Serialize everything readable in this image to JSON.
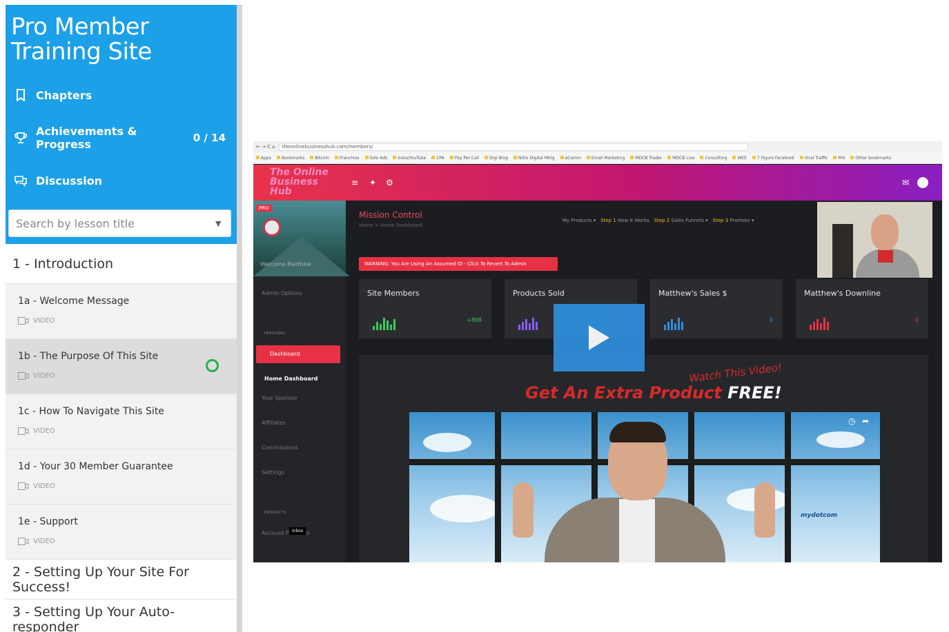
{
  "sidebar": {
    "title": "Pro Member Training Site",
    "nav": {
      "chapters": "Chapters",
      "achievements": "Achievements & Progress",
      "achievements_count": "0 / 14",
      "discussion": "Discussion"
    },
    "search": {
      "placeholder": "Search by lesson title"
    },
    "chapters": [
      {
        "label": "1 - Introduction"
      },
      {
        "label": "2 - Setting Up Your Site For Success!"
      },
      {
        "label": "3 - Setting Up Your Auto-responder"
      }
    ],
    "lessons": [
      {
        "title": "1a - Welcome Message",
        "type": "VIDEO"
      },
      {
        "title": "1b - The Purpose Of This Site",
        "type": "VIDEO"
      },
      {
        "title": "1c - How To Navigate This Site",
        "type": "VIDEO"
      },
      {
        "title": "1d - Your 30 Member Guarantee",
        "type": "VIDEO"
      },
      {
        "title": "1e - Support",
        "type": "VIDEO"
      }
    ]
  },
  "video": {
    "browser_url": "theonlinebusinesshub.com/members/",
    "bookmarks": [
      "Apps",
      "Bookmarks",
      "Bitcoin",
      "Franchise",
      "Solo Ads",
      "Insta/YouTube",
      "CPA",
      "Pay Per Call",
      "Digi Blog",
      "Nitro Digital Mktg",
      "eComm",
      "Email Marketing",
      "MDCB Trader",
      "MDCB Live",
      "Consulting",
      "WEE",
      "7 Figure Facebook",
      "Viral Traffic",
      "PHI",
      "Other bookmarks"
    ],
    "logo": "The Online Business Hub",
    "pro_badge": "PRO",
    "welcome": "Welcome Matthew",
    "side_items": {
      "admin": "Admin Options",
      "personal": "PERSONAL",
      "dashboard": "Dashboard",
      "home_dashboard": "Home Dashboard",
      "your_sponsor": "Your Sponsor",
      "affiliates": "Affiliates",
      "commissions": "Commissions",
      "settings": "Settings",
      "products": "PRODUCTS",
      "account": "Account Products",
      "inbox": "Inbox"
    },
    "page_title": "Mission Control",
    "breadcrumb": "Home  >  Home Dashboard",
    "menu": {
      "my_products": "My Products ▾",
      "step1": "Step 1",
      "step1_text": "How It Works",
      "step2": "Step 2",
      "step2_text": "Sales Funnels ▾",
      "step3": "Step 3",
      "step3_text": "Promote ▾"
    },
    "warning": "WARNING: You Are Using An Assumed ID - Click To Revert To Admin",
    "stats": [
      {
        "label": "Site Members",
        "value": "+898",
        "color": "#3cc95b"
      },
      {
        "label": "Products Sold",
        "value": "",
        "color": "#8b5cf6"
      },
      {
        "label": "Matthew's Sales $",
        "value": "0",
        "color": "#2f8fdc"
      },
      {
        "label": "Matthew's Downline",
        "value": "0",
        "color": "#e73245"
      }
    ],
    "watch_text": "Watch This Video!",
    "headline_red": "Get An Extra Product",
    "headline_white": "FREE!",
    "brand": "mydotcom",
    "accent": "#2f8fdc"
  }
}
